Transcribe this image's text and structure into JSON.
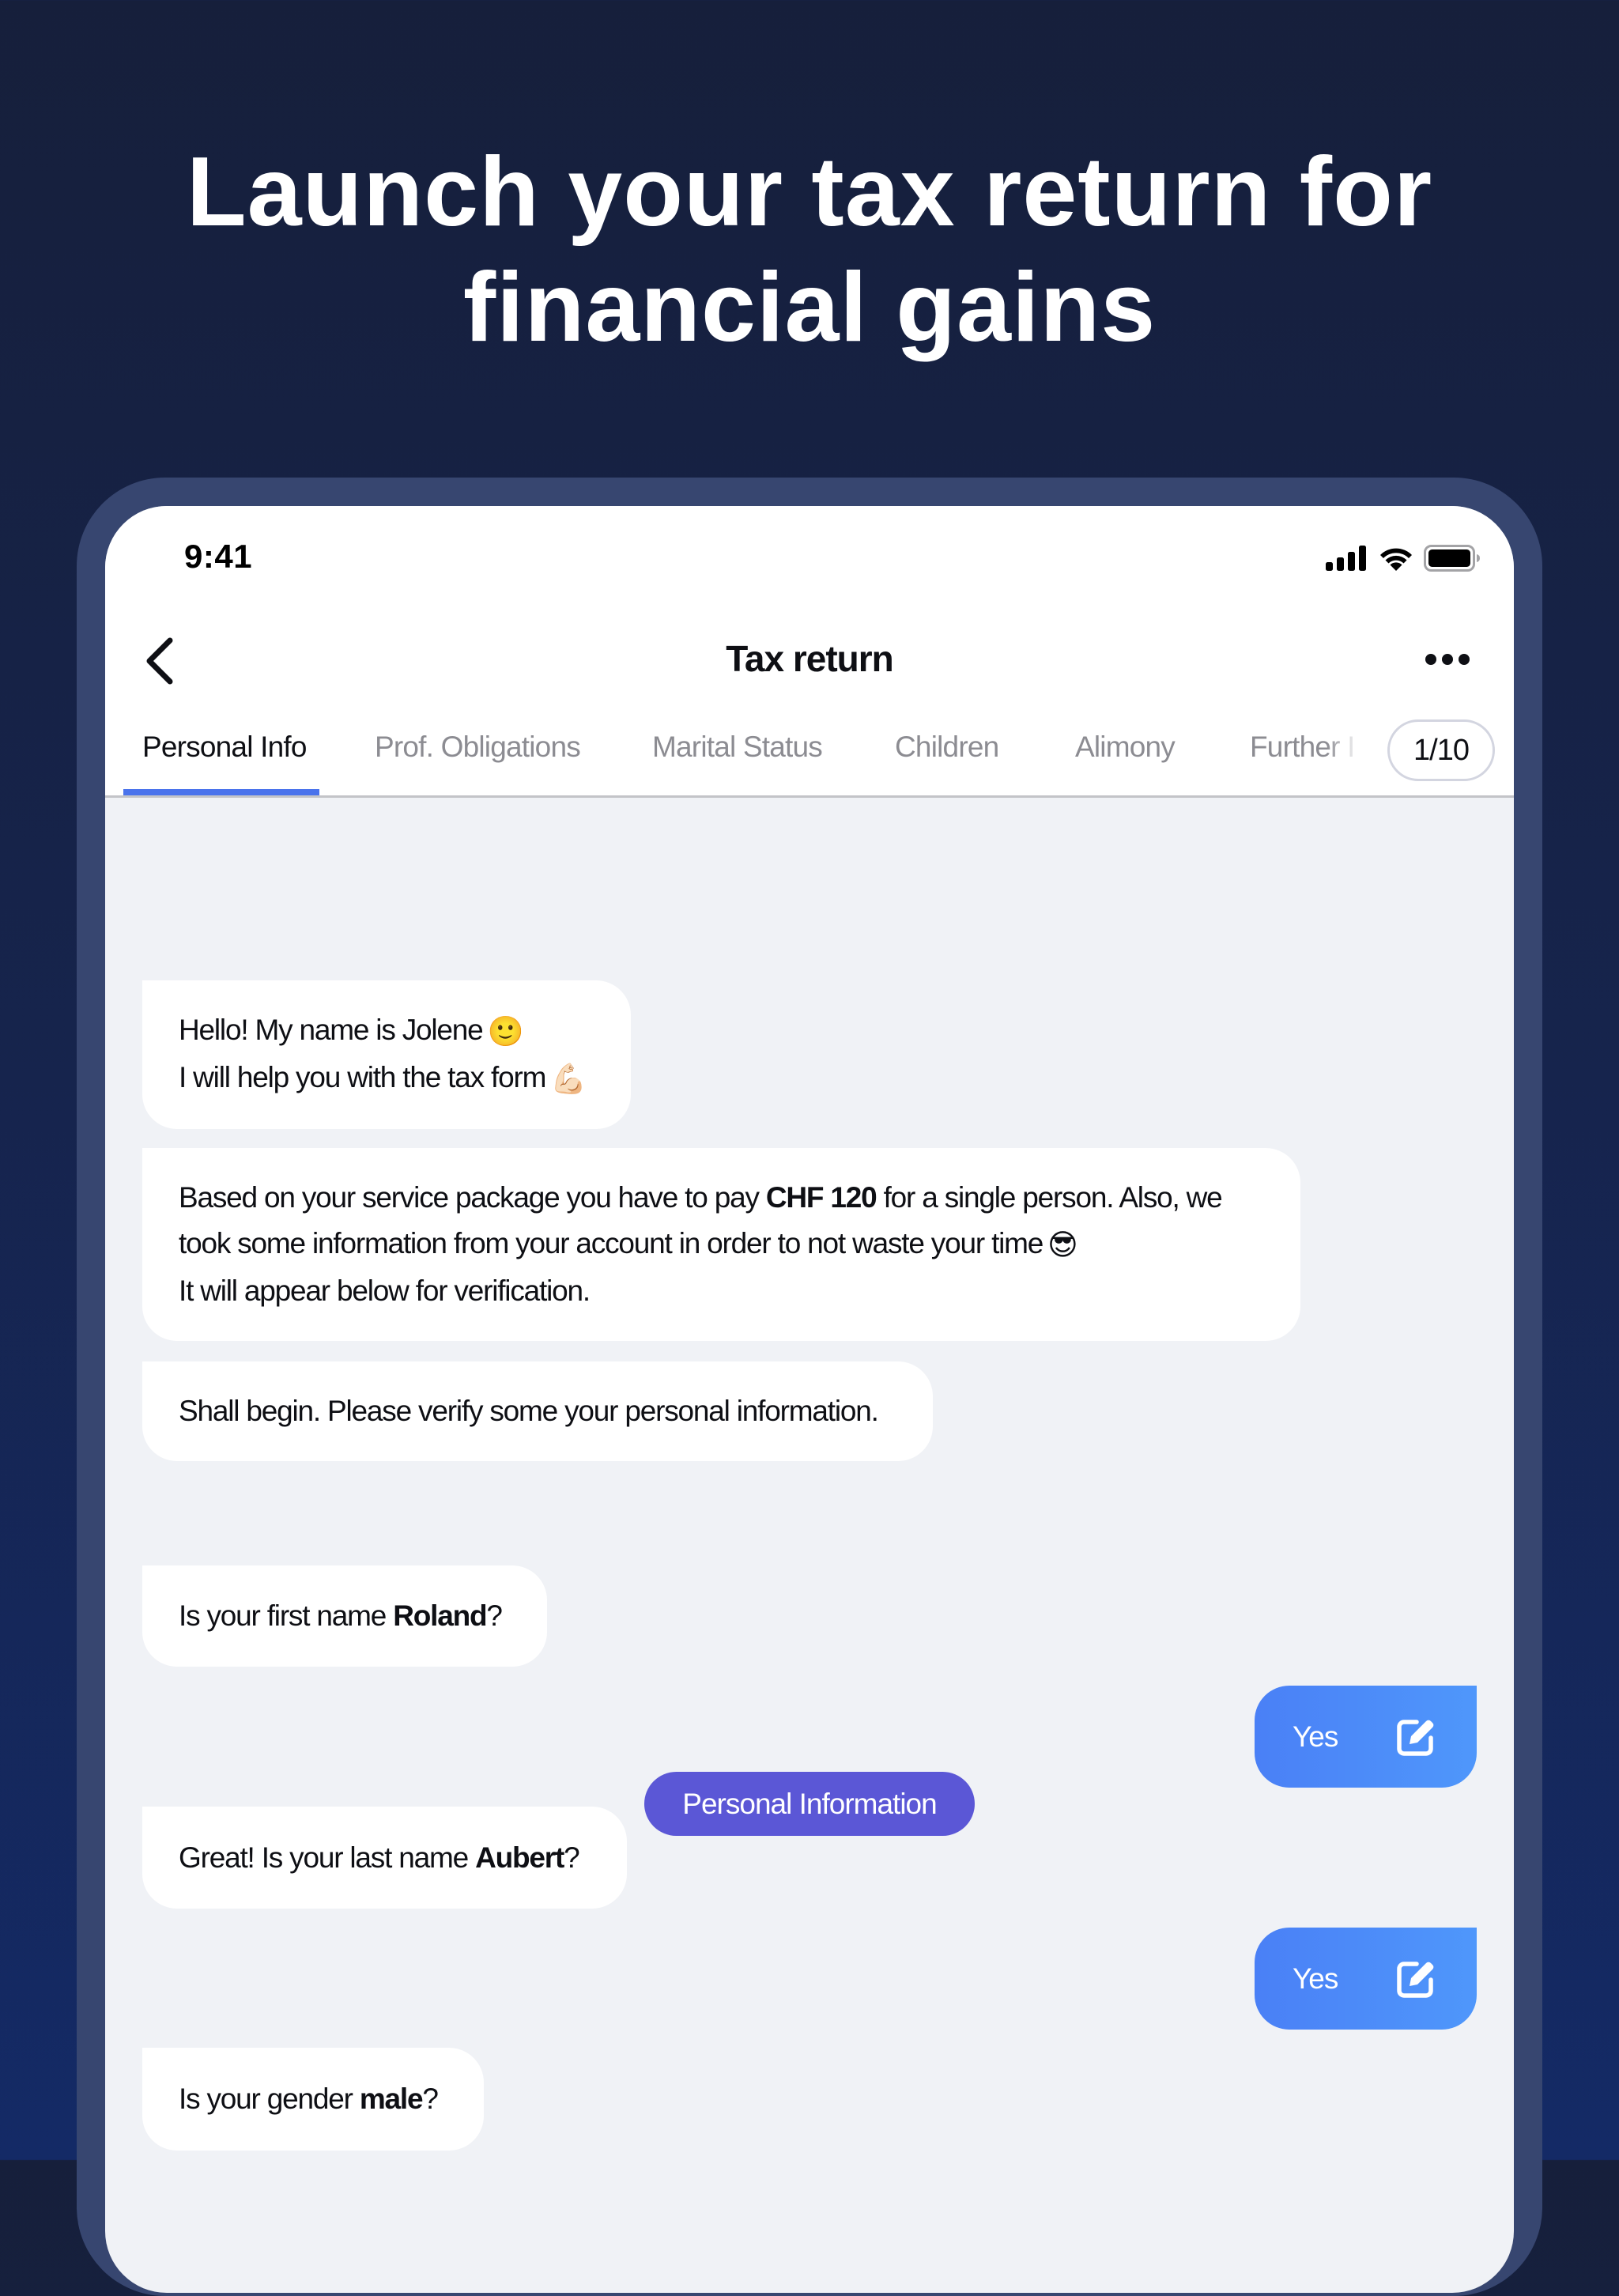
{
  "headline": {
    "line1": "Launch your tax return for",
    "line2": "financial gains"
  },
  "status_bar": {
    "time": "9:41",
    "icons": [
      "cellular-signal-icon",
      "wifi-icon",
      "battery-icon"
    ]
  },
  "nav": {
    "back_icon": "chevron-left-icon",
    "title": "Tax return",
    "more_icon": "more-horizontal-icon"
  },
  "tabs": {
    "items": [
      {
        "label": "Personal Info",
        "active": true
      },
      {
        "label": "Prof. Obligations",
        "active": false
      },
      {
        "label": "Marital Status",
        "active": false
      },
      {
        "label": "Children",
        "active": false
      },
      {
        "label": "Alimony",
        "active": false
      },
      {
        "label": "Further I",
        "active": false
      }
    ],
    "step_indicator": "1/10"
  },
  "colors": {
    "accent_blue": "#4a73ec",
    "section_pill": "#5b57d6",
    "reply_gradient_start": "#4a80f6",
    "reply_gradient_end": "#4f97fb",
    "chat_background": "#f0f2f6",
    "frame": "#374670"
  },
  "chat": {
    "messages": [
      {
        "from": "assistant",
        "lines": [
          {
            "text": "Hello! My name is Jolene",
            "emoji": "🙂"
          },
          {
            "text": "I will help you with the tax form",
            "emoji": "💪🏻"
          }
        ]
      },
      {
        "from": "assistant",
        "line1_pre": "Based on your service package you have to pay ",
        "line1_bold": "CHF 120",
        "line1_post": " for a single person. Also, we",
        "line2": "took some information from your account in order to not waste your time",
        "line2_emoji": "😎",
        "line3": "It will appear below for verification."
      },
      {
        "from": "assistant",
        "text": "Shall begin. Please verify some your personal information."
      },
      {
        "type": "section",
        "label": "Personal Information"
      },
      {
        "from": "assistant",
        "pre": "Is your first name ",
        "bold": "Roland",
        "post": "?"
      },
      {
        "from": "user",
        "text": "Yes",
        "icon": "edit-icon"
      },
      {
        "from": "assistant",
        "pre": "Great! Is your last name ",
        "bold": "Aubert",
        "post": "?"
      },
      {
        "from": "user",
        "text": "Yes",
        "icon": "edit-icon"
      },
      {
        "from": "assistant",
        "pre": "Is your gender ",
        "bold": "male",
        "post": "?"
      }
    ]
  }
}
